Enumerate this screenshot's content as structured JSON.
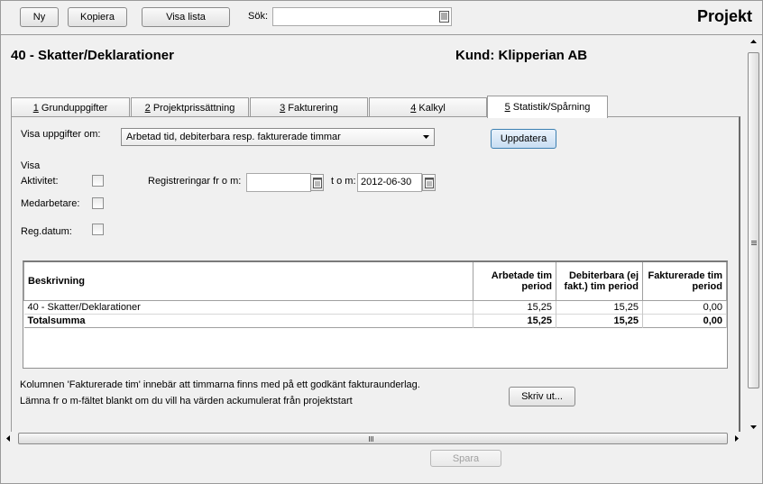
{
  "toolbar": {
    "new_label": "Ny",
    "copy_label": "Kopiera",
    "show_list_label": "Visa lista",
    "search_label": "Sök:",
    "search_value": ""
  },
  "app_title": "Projekt",
  "project_title": "40 - Skatter/Deklarationer",
  "customer_label": "Kund: Klipperian AB",
  "tabs": [
    {
      "key": "1",
      "label": "Grunduppgifter"
    },
    {
      "key": "2",
      "label": "Projektprissättning"
    },
    {
      "key": "3",
      "label": "Fakturering"
    },
    {
      "key": "4",
      "label": "Kalkyl"
    },
    {
      "key": "5",
      "label": "Statistik/Spårning"
    }
  ],
  "active_tab": 4,
  "form": {
    "show_data_label": "Visa uppgifter om:",
    "show_data_value": "Arbetad tid, debiterbara resp. fakturerade timmar",
    "update_label": "Uppdatera",
    "show_label": "Visa",
    "activity_label": "Aktivitet:",
    "employee_label": "Medarbetare:",
    "regdate_label": "Reg.datum:",
    "reg_from_label": "Registreringar fr o m:",
    "reg_from_value": "",
    "to_label": "t o m:",
    "to_value": "2012-06-30"
  },
  "table": {
    "headers": [
      "Beskrivning",
      "Arbetade tim period",
      "Debiterbara (ej fakt.) tim period",
      "Fakturerade tim period"
    ],
    "rows": [
      {
        "desc": "40 - Skatter/Deklarationer",
        "worked": "15,25",
        "billable": "15,25",
        "invoiced": "0,00"
      }
    ],
    "total": {
      "desc": "Totalsumma",
      "worked": "15,25",
      "billable": "15,25",
      "invoiced": "0,00"
    }
  },
  "notes": {
    "line1": "Kolumnen 'Fakturerade tim' innebär att timmarna finns med på ett godkänt fakturaunderlag.",
    "line2": "Lämna fr o m-fältet blankt om du vill ha värden ackumulerat från projektstart"
  },
  "print_label": "Skriv ut...",
  "save_label": "Spara"
}
